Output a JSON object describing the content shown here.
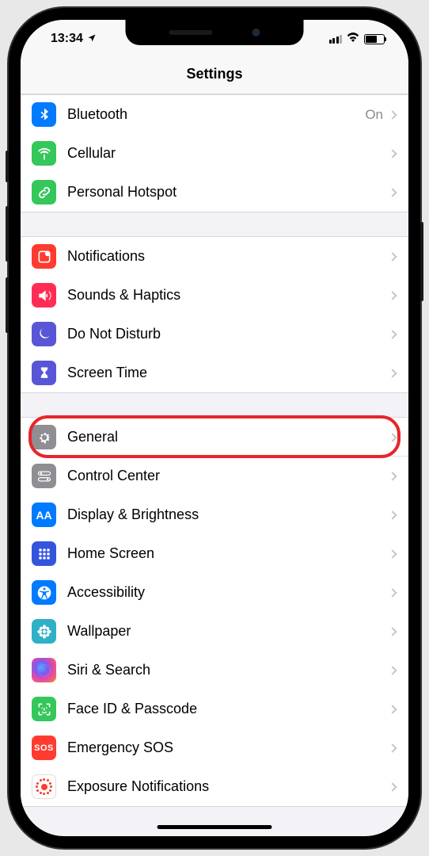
{
  "status": {
    "time": "13:34",
    "battery_pct": 60
  },
  "header": {
    "title": "Settings"
  },
  "groups": [
    {
      "rows": [
        {
          "id": "bluetooth",
          "label": "Bluetooth",
          "value": "On",
          "icon": "bluetooth-icon",
          "bg": "i-bluetooth"
        },
        {
          "id": "cellular",
          "label": "Cellular",
          "icon": "antenna-icon",
          "bg": "i-cellular"
        },
        {
          "id": "hotspot",
          "label": "Personal Hotspot",
          "icon": "link-icon",
          "bg": "i-hotspot"
        }
      ]
    },
    {
      "rows": [
        {
          "id": "notifications",
          "label": "Notifications",
          "icon": "notifications-icon",
          "bg": "i-notifications"
        },
        {
          "id": "sounds",
          "label": "Sounds & Haptics",
          "icon": "speaker-icon",
          "bg": "i-sounds"
        },
        {
          "id": "dnd",
          "label": "Do Not Disturb",
          "icon": "moon-icon",
          "bg": "i-dnd"
        },
        {
          "id": "screentime",
          "label": "Screen Time",
          "icon": "hourglass-icon",
          "bg": "i-screentime"
        }
      ]
    },
    {
      "rows": [
        {
          "id": "general",
          "label": "General",
          "icon": "gear-icon",
          "bg": "i-general",
          "highlight": true
        },
        {
          "id": "control",
          "label": "Control Center",
          "icon": "switches-icon",
          "bg": "i-control"
        },
        {
          "id": "display",
          "label": "Display & Brightness",
          "icon": "text-size-icon",
          "bg": "i-display"
        },
        {
          "id": "home",
          "label": "Home Screen",
          "icon": "grid-icon",
          "bg": "i-home"
        },
        {
          "id": "access",
          "label": "Accessibility",
          "icon": "accessibility-icon",
          "bg": "i-access"
        },
        {
          "id": "wallpaper",
          "label": "Wallpaper",
          "icon": "flower-icon",
          "bg": "i-wallpaper"
        },
        {
          "id": "siri",
          "label": "Siri & Search",
          "icon": "siri-icon",
          "bg": "i-siri"
        },
        {
          "id": "faceid",
          "label": "Face ID & Passcode",
          "icon": "faceid-icon",
          "bg": "i-faceid"
        },
        {
          "id": "sos",
          "label": "Emergency SOS",
          "icon": "sos-icon",
          "bg": "i-sos"
        },
        {
          "id": "exposure",
          "label": "Exposure Notifications",
          "icon": "exposure-icon",
          "bg": "i-exposure"
        }
      ]
    }
  ]
}
